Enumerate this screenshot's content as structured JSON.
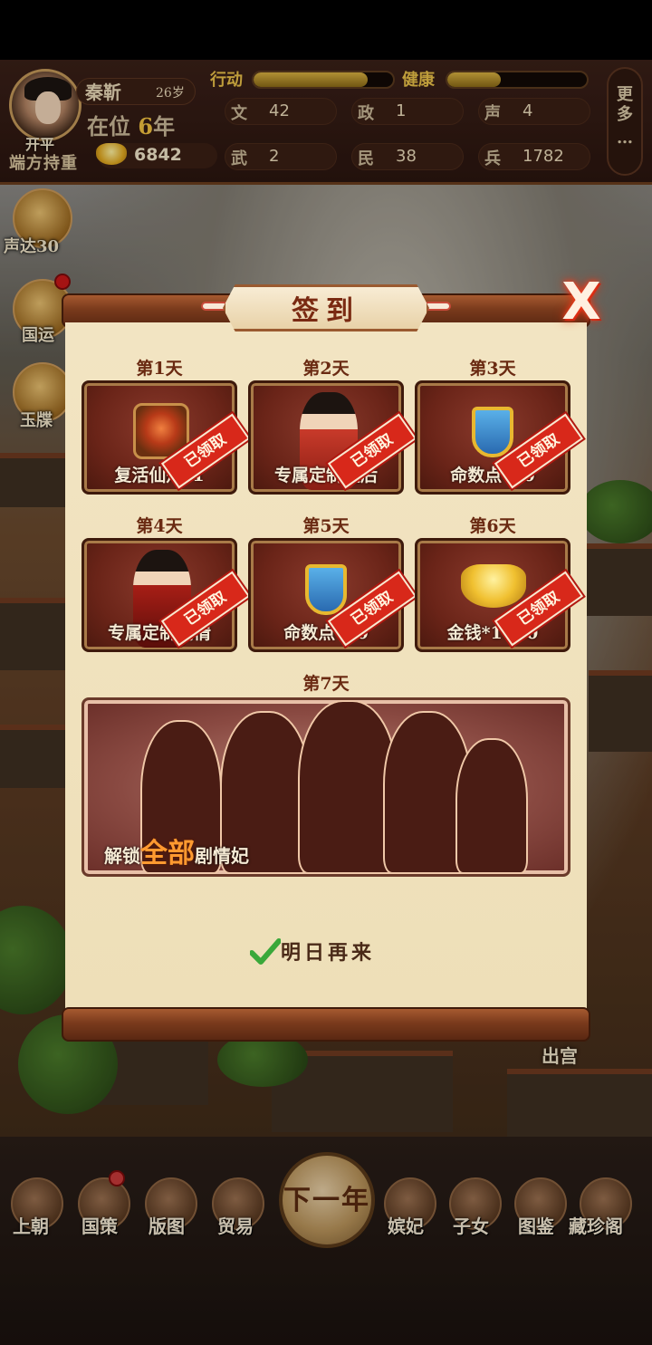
{
  "player": {
    "era": "开平",
    "title": "端方持重",
    "name": "秦靳",
    "age": "26岁",
    "reign_prefix": "在位",
    "reign_years": "6",
    "reign_suffix": "年",
    "gold": "6842"
  },
  "bars": {
    "action_label": "行动",
    "action_fill": 0.82,
    "health_label": "健康",
    "health_fill": 0.38
  },
  "stats": [
    {
      "key": "文",
      "value": "42"
    },
    {
      "key": "政",
      "value": "1"
    },
    {
      "key": "声",
      "value": "4"
    },
    {
      "key": "武",
      "value": "2"
    },
    {
      "key": "民",
      "value": "38"
    },
    {
      "key": "兵",
      "value": "1782"
    }
  ],
  "more_label": "更多",
  "more_dots": "…",
  "side": {
    "reputation_label": "声达30",
    "fortune_label": "国运",
    "jade_label": "玉牒"
  },
  "modal": {
    "title": "签到",
    "close": "X",
    "claimed": "已领取",
    "days": [
      {
        "label": "第1天",
        "item": "复活仙丹*1"
      },
      {
        "label": "第2天",
        "item": "专属定制皇后"
      },
      {
        "label": "第3天",
        "item": "命数点*10"
      },
      {
        "label": "第4天",
        "item": "专属定制剧情"
      },
      {
        "label": "第5天",
        "item": "命数点*10"
      },
      {
        "label": "第6天",
        "item": "金钱*1000"
      }
    ],
    "day7": {
      "label": "第7天",
      "unlock_prefix": "解锁",
      "unlock_highlight": "全部",
      "unlock_suffix": "剧情妃"
    },
    "come_back": "明日再来"
  },
  "exit_label": "出宫",
  "nav": {
    "court": "上朝",
    "policy": "国策",
    "map": "版图",
    "trade": "贸易",
    "next_year": "下一年",
    "consorts": "嫔妃",
    "children": "子女",
    "atlas": "图鉴",
    "treasury": "藏珍阁"
  },
  "colors": {
    "accent_gold": "#e8c048",
    "stamp_red": "#d8281a",
    "paper": "#f2e4c2"
  }
}
